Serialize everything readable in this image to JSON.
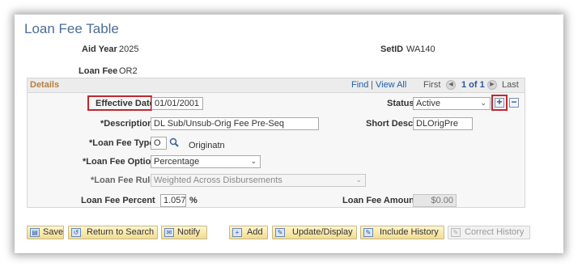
{
  "page": {
    "title": "Loan Fee Table"
  },
  "header": {
    "aid_year_label": "Aid Year",
    "aid_year_value": "2025",
    "setid_label": "SetID",
    "setid_value": "WA140",
    "loan_fee_label": "Loan Fee",
    "loan_fee_value": "OR2"
  },
  "details": {
    "title": "Details",
    "find_link": "Find",
    "separator": "|",
    "view_all_link": "View All",
    "first_label": "First",
    "page_indicator": "1 of 1",
    "last_label": "Last"
  },
  "form": {
    "effective_date_label": "Effective Date",
    "effective_date_value": "01/01/2001",
    "status_label": "Status",
    "status_value": "Active",
    "description_label": "*Description",
    "description_value": "DL Sub/Unsub-Orig Fee Pre-Seq",
    "short_descr_label": "Short Descr",
    "short_descr_value": "DLOrigPre",
    "loan_fee_type_label": "*Loan Fee Type",
    "loan_fee_type_value": "O",
    "loan_fee_type_desc": "Originatn",
    "loan_fee_option_label": "*Loan Fee Option",
    "loan_fee_option_value": "Percentage",
    "loan_fee_rule_label": "*Loan Fee Rule",
    "loan_fee_rule_value": "Weighted Across Disbursements",
    "loan_fee_percent_label": "Loan Fee Percent",
    "loan_fee_percent_value": "1.057",
    "percent_sign": "%",
    "loan_fee_amount_label": "Loan Fee Amount",
    "loan_fee_amount_value": "$0.00",
    "add_row_symbol": "+",
    "delete_row_symbol": "−"
  },
  "toolbar": {
    "save": "Save",
    "return_to_search": "Return to Search",
    "notify": "Notify",
    "add": "Add",
    "update_display": "Update/Display",
    "include_history": "Include History",
    "correct_history": "Correct History"
  },
  "colors": {
    "title": "#4a6d96",
    "details_title": "#b77f3a",
    "link": "#1e5ea8",
    "highlight_box": "#c0282f",
    "button_face": "#f3dc8f"
  }
}
